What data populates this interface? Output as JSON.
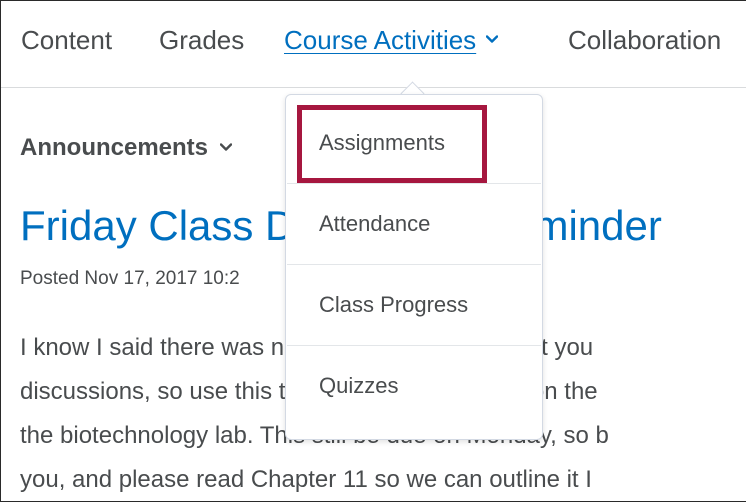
{
  "nav": {
    "items": [
      {
        "label": "Content"
      },
      {
        "label": "Grades"
      },
      {
        "label": "Course Activities"
      },
      {
        "label": "Collaboration"
      }
    ]
  },
  "widget": {
    "title": "Announcements"
  },
  "announcement": {
    "title": "Friday Class Discussion Reminder",
    "posted": "Posted Nov 17, 2017 10:2",
    "body_lines": [
      "I know I said there was no class Friday, but I want you",
      "discussions, so use this time to get a head start on the",
      "the biotechnology lab. This still be due on Monday, so b",
      "you,  and please read Chapter 11 so we can outline it I"
    ]
  },
  "dropdown": {
    "items": [
      {
        "label": "Assignments"
      },
      {
        "label": "Attendance"
      },
      {
        "label": "Class Progress"
      },
      {
        "label": "Quizzes"
      }
    ]
  },
  "colors": {
    "link": "#006fbf",
    "text": "#494c4e",
    "highlight": "#a6173f"
  }
}
